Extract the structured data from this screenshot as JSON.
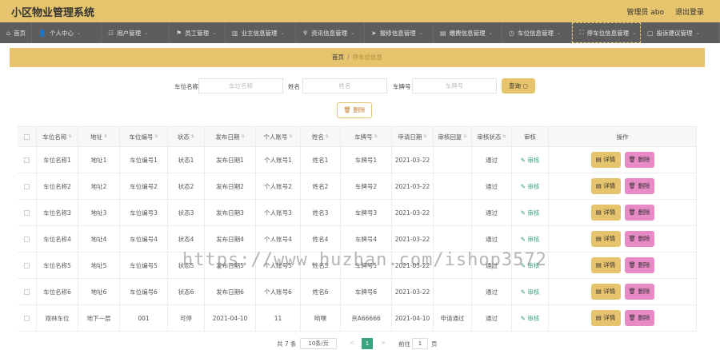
{
  "header": {
    "title": "小区物业管理系统",
    "user_label": "管理员 abo",
    "logout_label": "退出登录"
  },
  "nav": [
    {
      "label": "首页",
      "icon": "home-icon"
    },
    {
      "label": "个人中心",
      "icon": "user-icon"
    },
    {
      "label": "用户管理",
      "icon": "users-icon"
    },
    {
      "label": "员工管理",
      "icon": "flag-icon"
    },
    {
      "label": "业主信息管理",
      "icon": "bar-chart-icon"
    },
    {
      "label": "资讯信息管理",
      "icon": "cup-icon"
    },
    {
      "label": "报修信息管理",
      "icon": "send-icon"
    },
    {
      "label": "缴费信息管理",
      "icon": "document-icon"
    },
    {
      "label": "车位信息管理",
      "icon": "clock-icon"
    },
    {
      "label": "停车位信息管理",
      "icon": "frame-icon"
    },
    {
      "label": "投诉建议管理",
      "icon": "window-icon"
    }
  ],
  "breadcrumb": {
    "home": "首页",
    "separator": "/",
    "current": "停车位信息"
  },
  "search": {
    "parking_name_label": "车位名称",
    "parking_name_placeholder": "车位名称",
    "name_label": "姓名",
    "name_placeholder": "姓名",
    "plate_label": "车牌号",
    "plate_placeholder": "车牌号",
    "query_label": "查询 ○"
  },
  "delete_button": "删除",
  "table": {
    "columns": [
      "车位名称",
      "地址",
      "车位编号",
      "状态",
      "发布日期",
      "个人账号",
      "姓名",
      "车牌号",
      "申请日期",
      "审核回复",
      "审核状态",
      "审核",
      "操作"
    ],
    "rows": [
      [
        "车位名称1",
        "地址1",
        "车位编号1",
        "状态1",
        "发布日期1",
        "个人账号1",
        "姓名1",
        "车牌号1",
        "2021-03-22",
        "",
        "通过"
      ],
      [
        "车位名称2",
        "地址2",
        "车位编号2",
        "状态2",
        "发布日期2",
        "个人账号2",
        "姓名2",
        "车牌号2",
        "2021-03-22",
        "",
        "通过"
      ],
      [
        "车位名称3",
        "地址3",
        "车位编号3",
        "状态3",
        "发布日期3",
        "个人账号3",
        "姓名3",
        "车牌号3",
        "2021-03-22",
        "",
        "通过"
      ],
      [
        "车位名称4",
        "地址4",
        "车位编号4",
        "状态4",
        "发布日期4",
        "个人账号4",
        "姓名4",
        "车牌号4",
        "2021-03-22",
        "",
        "通过"
      ],
      [
        "车位名称5",
        "地址5",
        "车位编号5",
        "状态5",
        "发布日期5",
        "个人账号5",
        "姓名5",
        "车牌号5",
        "2021-03-22",
        "",
        "通过"
      ],
      [
        "车位名称6",
        "地址6",
        "车位编号6",
        "状态6",
        "发布日期6",
        "个人账号6",
        "姓名6",
        "车牌号6",
        "2021-03-22",
        "",
        "通过"
      ],
      [
        "观林车位",
        "地下一层",
        "001",
        "可停",
        "2021-04-10",
        "11",
        "哟嘿",
        "京A66666",
        "2021-04-10",
        "申请通过",
        "通过"
      ]
    ],
    "audit_label": "审核",
    "edit_label": "详情",
    "delete_label": "删除"
  },
  "pagination": {
    "total": "共 7 条",
    "page_size": "10条/页",
    "prev": "<",
    "current": "1",
    "next": ">",
    "goto_label": "前往",
    "goto_value": "1",
    "page_unit": "页"
  },
  "watermark": "https://www.huzhan.com/ishop3572",
  "colors": {
    "accent": "#e6c36d",
    "nav_bg": "#5d5d5d",
    "delete_btn": "#e88ac6",
    "link_green": "#3aa37d"
  }
}
